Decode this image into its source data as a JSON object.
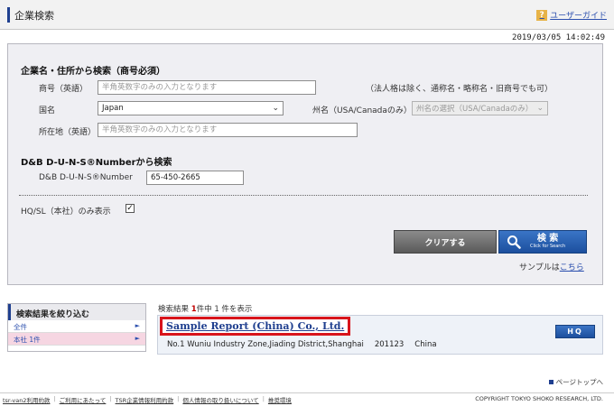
{
  "header": {
    "title": "企業検索",
    "guide_link": "ユーザーガイド",
    "guide_icon": "help-question-icon"
  },
  "timestamp": "2019/03/05 14:02:49",
  "search_form": {
    "section1_title": "企業名・住所から検索（商号必須）",
    "company_name_label": "商号（英語）",
    "company_name_placeholder": "半角英数字のみの入力となります",
    "company_name_note": "（法人格は除く、通称名・略称名・旧商号でも可）",
    "country_label": "国名",
    "country_value": "Japan",
    "state_label": "州名（USA/Canadaのみ）",
    "state_placeholder": "州名の選択（USA/Canadaのみ）",
    "address_label": "所在地（英語）",
    "address_placeholder": "半角英数字のみの入力となります",
    "section2_title": "D&B D-U-N-S®Numberから検索",
    "duns_label": "D&B D-U-N-S®Number",
    "duns_value": "65-450-2665",
    "hq_label": "HQ/SL（本社）のみ表示",
    "hq_checked": "✓",
    "clear_button": "クリアする",
    "search_button": "検 索",
    "search_button_sub": "Click for Search",
    "sample_text": "サンプルは",
    "sample_link": "こちら"
  },
  "refine": {
    "title": "検索結果を絞り込む",
    "items": [
      {
        "label": "全件",
        "arrow": "►"
      },
      {
        "label": "本社 1件",
        "arrow": "►"
      }
    ]
  },
  "results": {
    "summary_prefix": "検索結果 ",
    "summary_count": "1",
    "summary_suffix": "件中 1 件を表示",
    "items": [
      {
        "company_name": "Sample Report (China) Co., Ltd.",
        "badge": "HQ",
        "address": "No.1 Wuniu Industry Zone,Jiading District,Shanghai",
        "postal_code": "201123",
        "country": "China"
      }
    ]
  },
  "pagetop": "ページトップへ",
  "footer": {
    "links": [
      "tsr-van2利用約款",
      "ご利用にあたって",
      "TSR企業情報利用約款",
      "個人情報の取り扱いについて",
      "推奨環境"
    ],
    "copyright": "COPYRIGHT TOKYO SHOKO RESEARCH, LTD."
  },
  "colors": {
    "accent": "#1f3f8f",
    "link": "#2b4fae",
    "highlight_border": "#d8141b",
    "search_button": "#1c4f9e"
  }
}
